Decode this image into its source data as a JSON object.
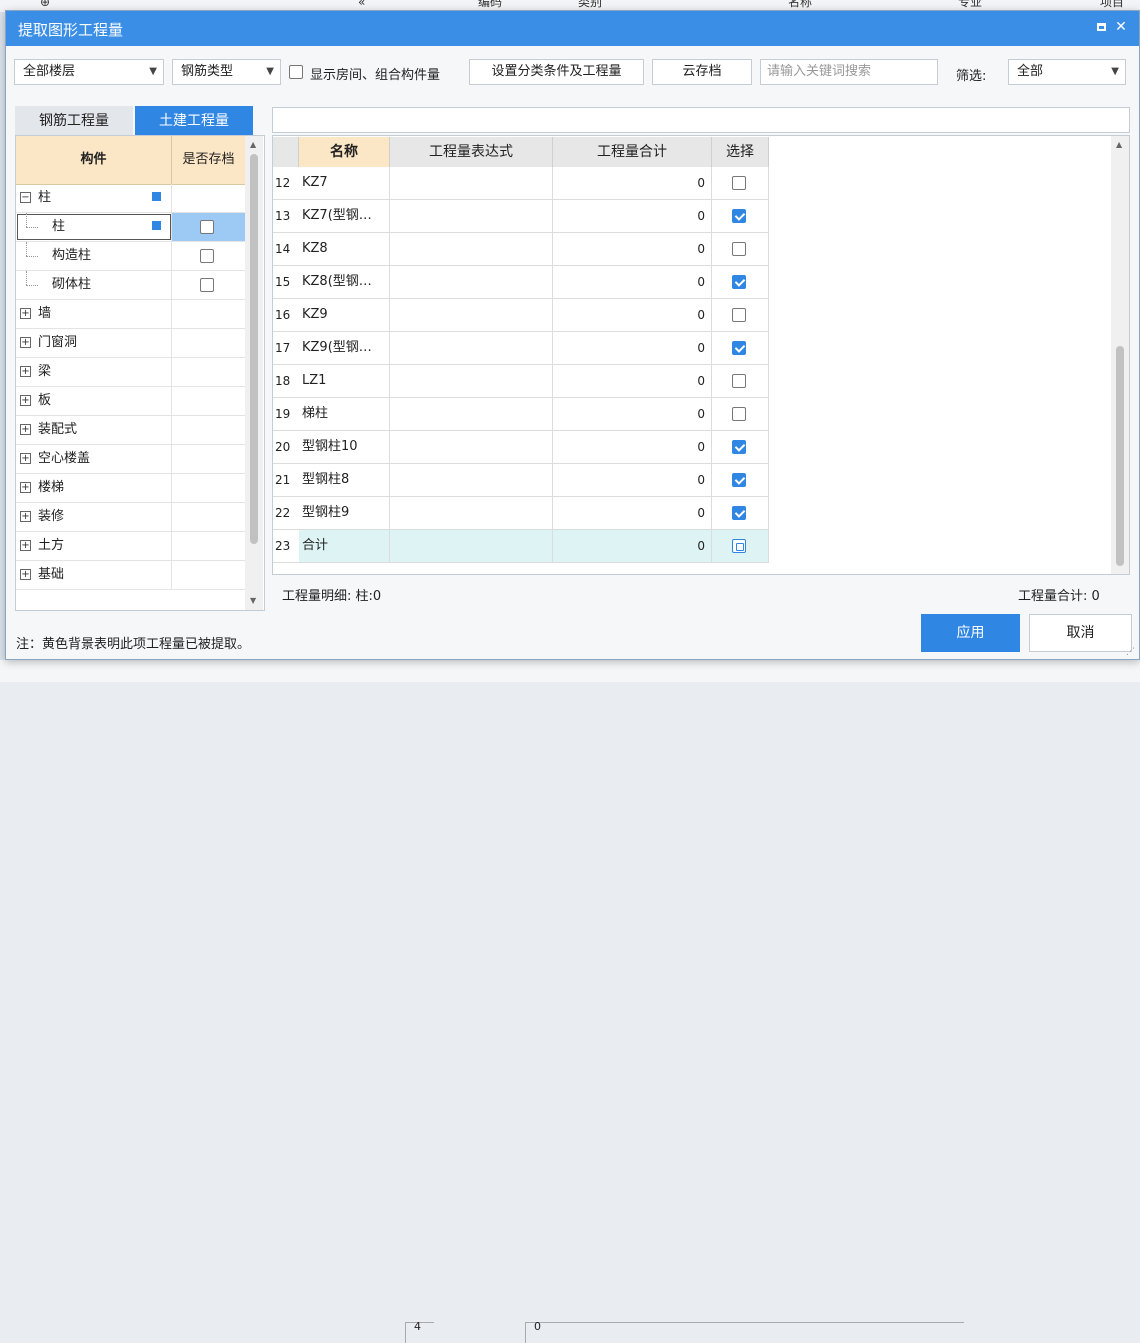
{
  "background": {
    "columns": [
      "编码",
      "类别",
      "名称",
      "专业",
      "项目"
    ],
    "bottom_cells": [
      "4",
      "0"
    ]
  },
  "dialog": {
    "title": "提取图形工程量",
    "close_glyph": "✕"
  },
  "toolbar": {
    "floor_select": "全部楼层",
    "rebar_type_select": "钢筋类型",
    "show_rooms_label": "显示房间、组合构件量",
    "show_rooms_checked": false,
    "set_conditions_button": "设置分类条件及工程量",
    "cloud_archive_button": "云存档",
    "search_placeholder": "请输入关键词搜索",
    "filter_label": "筛选:",
    "filter_select": "全部",
    "dropdown_arrow": "▼"
  },
  "tabs": [
    {
      "label": "钢筋工程量",
      "active": false
    },
    {
      "label": "土建工程量",
      "active": true
    }
  ],
  "tree": {
    "headers": [
      "构件",
      "是否存档"
    ],
    "items": [
      {
        "label": "柱",
        "expander": "−",
        "level": 0,
        "pin": true,
        "checkbox": false
      },
      {
        "label": "柱",
        "expander": "",
        "level": 1,
        "pin": true,
        "checkbox": true,
        "checked": false,
        "selected": true
      },
      {
        "label": "构造柱",
        "expander": "",
        "level": 1,
        "pin": false,
        "checkbox": true,
        "checked": false
      },
      {
        "label": "砌体柱",
        "expander": "",
        "level": 1,
        "pin": false,
        "checkbox": true,
        "checked": false
      },
      {
        "label": "墙",
        "expander": "+",
        "level": 0,
        "pin": false,
        "checkbox": false
      },
      {
        "label": "门窗洞",
        "expander": "+",
        "level": 0,
        "pin": false,
        "checkbox": false
      },
      {
        "label": "梁",
        "expander": "+",
        "level": 0,
        "pin": false,
        "checkbox": false
      },
      {
        "label": "板",
        "expander": "+",
        "level": 0,
        "pin": false,
        "checkbox": false
      },
      {
        "label": "装配式",
        "expander": "+",
        "level": 0,
        "pin": false,
        "checkbox": false
      },
      {
        "label": "空心楼盖",
        "expander": "+",
        "level": 0,
        "pin": false,
        "checkbox": false
      },
      {
        "label": "楼梯",
        "expander": "+",
        "level": 0,
        "pin": false,
        "checkbox": false
      },
      {
        "label": "装修",
        "expander": "+",
        "level": 0,
        "pin": false,
        "checkbox": false
      },
      {
        "label": "土方",
        "expander": "+",
        "level": 0,
        "pin": false,
        "checkbox": false
      },
      {
        "label": "基础",
        "expander": "+",
        "level": 0,
        "pin": false,
        "checkbox": false
      }
    ]
  },
  "grid": {
    "headers": [
      "名称",
      "工程量表达式",
      "工程量合计",
      "选择"
    ],
    "rows": [
      {
        "num": "12",
        "name": "KZ7",
        "expr": "",
        "total": "0",
        "selected": false
      },
      {
        "num": "13",
        "name": "KZ7(型钢…",
        "expr": "",
        "total": "0",
        "selected": true
      },
      {
        "num": "14",
        "name": "KZ8",
        "expr": "",
        "total": "0",
        "selected": false
      },
      {
        "num": "15",
        "name": "KZ8(型钢…",
        "expr": "",
        "total": "0",
        "selected": true
      },
      {
        "num": "16",
        "name": "KZ9",
        "expr": "",
        "total": "0",
        "selected": false
      },
      {
        "num": "17",
        "name": "KZ9(型钢…",
        "expr": "",
        "total": "0",
        "selected": true
      },
      {
        "num": "18",
        "name": "LZ1",
        "expr": "",
        "total": "0",
        "selected": false
      },
      {
        "num": "19",
        "name": "梯柱",
        "expr": "",
        "total": "0",
        "selected": false
      },
      {
        "num": "20",
        "name": "型钢柱10",
        "expr": "",
        "total": "0",
        "selected": true
      },
      {
        "num": "21",
        "name": "型钢柱8",
        "expr": "",
        "total": "0",
        "selected": true
      },
      {
        "num": "22",
        "name": "型钢柱9",
        "expr": "",
        "total": "0",
        "selected": true
      },
      {
        "num": "23",
        "name": "合计",
        "expr": "",
        "total": "0",
        "selected": "partial"
      }
    ]
  },
  "status": {
    "detail": "工程量明细:  柱:0",
    "total": "工程量合计:  0"
  },
  "footer": {
    "note": "注：黄色背景表明此项工程量已被提取。",
    "apply_button": "应用",
    "cancel_button": "取消"
  },
  "colors": {
    "accent": "#2f86e3",
    "title_bar": "#3a8ee6",
    "header_highlight": "#fbe7c6",
    "total_row": "#def4f4",
    "selected_cell": "#9dc9f5"
  }
}
